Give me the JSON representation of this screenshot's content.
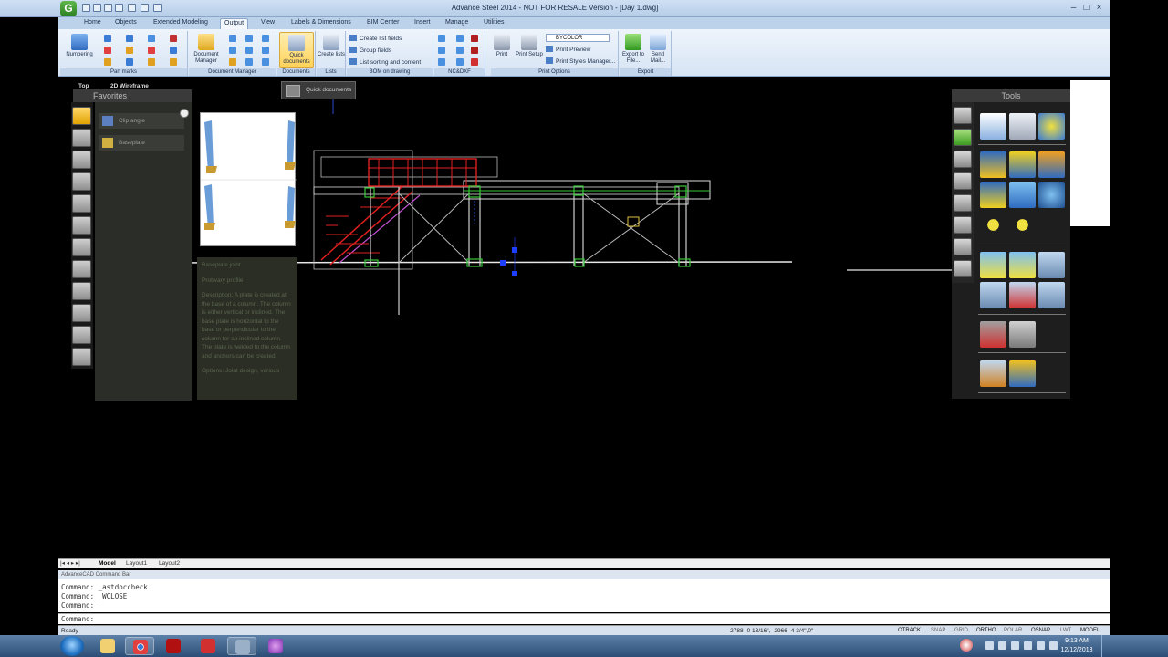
{
  "window": {
    "title": "Advance Steel 2014 - NOT FOR RESALE Version - [Day 1.dwg]",
    "minimize": "–",
    "maximize": "□",
    "close": "×"
  },
  "ribbon": {
    "tabs": [
      "Home",
      "Objects",
      "Extended Modeling",
      "Output",
      "View",
      "Labels & Dimensions",
      "BIM Center",
      "Insert",
      "Manage",
      "Utilities"
    ],
    "active_tab": "Output",
    "groups": {
      "part_marks": {
        "label": "Part marks",
        "numbering": "Numbering"
      },
      "document_manager": {
        "label": "Document Manager",
        "btn": "Document Manager"
      },
      "documents": {
        "label": "Documents",
        "btn": "Quick documents"
      },
      "lists": {
        "label": "Lists",
        "btn": "Create lists"
      },
      "bom": {
        "label": "BOM on drawing",
        "items": [
          "Create list fields",
          "Group fields",
          "List sorting and content"
        ]
      },
      "ncdxf": {
        "label": "NC&DXF"
      },
      "print_options": {
        "label": "Print Options",
        "print": "Print",
        "print_setup": "Print Setup",
        "combo_value": "BYCOLOR",
        "print_preview": "Print Preview",
        "print_styles": "Print Styles Manager..."
      },
      "export": {
        "label": "Export",
        "export_file": "Export to File...",
        "send_mail": "Send Mail..."
      }
    }
  },
  "tooltip": {
    "text": "Quick documents"
  },
  "viewport": {
    "view": "Top",
    "style": "2D Wireframe"
  },
  "favorites": {
    "title": "Favorites",
    "items": [
      "Clip angle",
      "Baseplate"
    ],
    "description": [
      "Baseplate joint",
      "Prot/vary profile",
      "Description: A plate is created at the base of a column. The column is either vertical or inclined. The base plate is horizontal to the base or perpendicular to the column for an inclined column. The plate is welded to the column and anchors can be created.",
      "Options: Joint design, various"
    ]
  },
  "tools": {
    "title": "Tools"
  },
  "layouts": {
    "nav": "|◂ ◂ ▸ ▸|",
    "tabs": [
      "Model",
      "Layout1",
      "Layout2"
    ],
    "active": "Model"
  },
  "command": {
    "bar_title": "AdvanceCAD Command Bar",
    "lines": [
      "Command: _astdoccheck",
      "Command: _WCLOSE",
      "Command:"
    ],
    "prompt": "Command:"
  },
  "status": {
    "ready": "Ready",
    "coords": "-2788 -0 13/16\", -2966 -4 3/4\",0\"",
    "toggles": [
      "OTRACK",
      "SNAP",
      "GRID",
      "ORTHO",
      "POLAR",
      "OSNAP",
      "LWT",
      "MODEL"
    ],
    "toggles_on": [
      "OTRACK",
      "ORTHO",
      "OSNAP",
      "MODEL"
    ]
  },
  "taskbar": {
    "time": "9:13 AM",
    "date": "12/12/2013"
  },
  "colors": {
    "ribbon": "#d7e4f4",
    "canvas": "#000000",
    "structure_red": "#e02020",
    "structure_green": "#37c837",
    "grip_blue": "#1f3fff"
  }
}
